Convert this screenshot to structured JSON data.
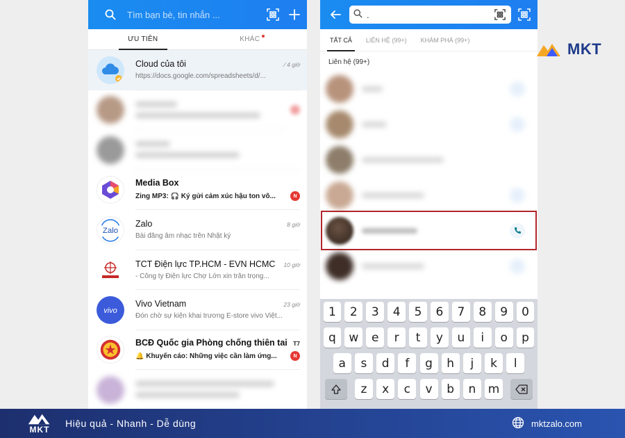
{
  "left_screen": {
    "search_placeholder": "Tìm bạn bè, tin nhắn ...",
    "tabs": [
      {
        "label": "ƯU TIÊN",
        "active": true
      },
      {
        "label": "KHÁC",
        "active": false,
        "has_dot": true
      }
    ],
    "conversations": [
      {
        "name": "Cloud của tôi",
        "time": "4 giờ",
        "message": "https://docs.google.com/spreadsheets/d/...",
        "pinned": true,
        "avatar": "cloud-icon"
      },
      {
        "blurred": true
      },
      {
        "blurred": true
      },
      {
        "name": "Media Box",
        "time": "",
        "message": "Zing MP3: 🎧 Ký gửi cảm xúc hậu ton vô...",
        "bold": true,
        "badge": "N",
        "avatar": "media-box-icon"
      },
      {
        "name": "Zalo",
        "time": "8 giờ",
        "message": "Bài đăng âm nhạc trên Nhật ký",
        "avatar": "zalo-logo"
      },
      {
        "name": "TCT Điện lực TP.HCM - EVN HCMC",
        "time": "10 giờ",
        "message": "- Công ty Điện lực Chợ Lớn xin trân trọng...",
        "avatar": "evn-logo"
      },
      {
        "name": "Vivo Vietnam",
        "time": "23 giờ",
        "message": "Đón chờ sự kiện khai trương E-store vivo Việt...",
        "avatar": "vivo-logo"
      },
      {
        "name": "BCĐ Quốc gia Phòng chống thiên tai",
        "time": "T7",
        "message": "🔔 Khuyến cáo: Những việc cần làm ứng...",
        "bold": true,
        "time_bold": true,
        "badge": "N",
        "avatar": "emblem-logo"
      },
      {
        "blurred": true
      }
    ]
  },
  "right_screen": {
    "search_query": ".",
    "tabs": [
      {
        "label": "TẤT CẢ",
        "active": true
      },
      {
        "label": "LIÊN HỆ (99+)",
        "active": false
      },
      {
        "label": "KHÁM PHÁ (99+)",
        "active": false
      }
    ],
    "section_label": "Liên hệ (99+)",
    "keyboard": {
      "numbers": [
        "1",
        "2",
        "3",
        "4",
        "5",
        "6",
        "7",
        "8",
        "9",
        "0"
      ],
      "row1": [
        "q",
        "w",
        "e",
        "r",
        "t",
        "y",
        "u",
        "i",
        "o",
        "p"
      ],
      "row2": [
        "a",
        "s",
        "d",
        "f",
        "g",
        "h",
        "j",
        "k",
        "l"
      ],
      "row3": [
        "z",
        "x",
        "c",
        "v",
        "b",
        "n",
        "m"
      ]
    }
  },
  "branding": {
    "logo_text": "MKT",
    "slogan": "Hiệu quả - Nhanh - Dễ dùng",
    "website": "mktzalo.com"
  },
  "colors": {
    "zalo_blue": "#1a8cf0",
    "banner_dark": "#1d2f6e",
    "highlight_red": "#b0252a",
    "badge_red": "#e53935"
  }
}
